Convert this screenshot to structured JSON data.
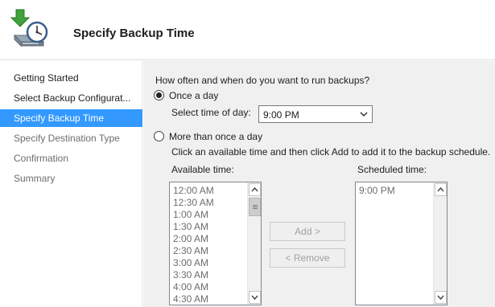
{
  "header": {
    "title": "Specify Backup Time",
    "icon": "backup-clock-icon"
  },
  "sidebar": {
    "items": [
      {
        "label": "Getting Started",
        "state": "normal"
      },
      {
        "label": "Select Backup Configurat...",
        "state": "normal"
      },
      {
        "label": "Specify Backup Time",
        "state": "active"
      },
      {
        "label": "Specify Destination Type",
        "state": "dim"
      },
      {
        "label": "Confirmation",
        "state": "dim"
      },
      {
        "label": "Summary",
        "state": "dim"
      }
    ]
  },
  "main": {
    "question": "How often and when do you want to run backups?",
    "once_a_day": {
      "label": "Once a day",
      "checked": true,
      "time_label": "Select time of day:",
      "time_value": "9:00 PM"
    },
    "more_than_once": {
      "label": "More than once a day",
      "checked": false,
      "instruction": "Click an available time and then click Add to add it to the backup schedule."
    },
    "available": {
      "label": "Available time:",
      "items": [
        "12:00 AM",
        "12:30 AM",
        "1:00 AM",
        "1:30 AM",
        "2:00 AM",
        "2:30 AM",
        "3:00 AM",
        "3:30 AM",
        "4:00 AM",
        "4:30 AM"
      ]
    },
    "scheduled": {
      "label": "Scheduled time:",
      "items": [
        "9:00 PM"
      ]
    },
    "add_button": "Add >",
    "remove_button": "< Remove"
  },
  "colors": {
    "accent": "#3399ff",
    "content_bg": "#f0f0f0",
    "disabled_text": "#6d6d6d"
  }
}
